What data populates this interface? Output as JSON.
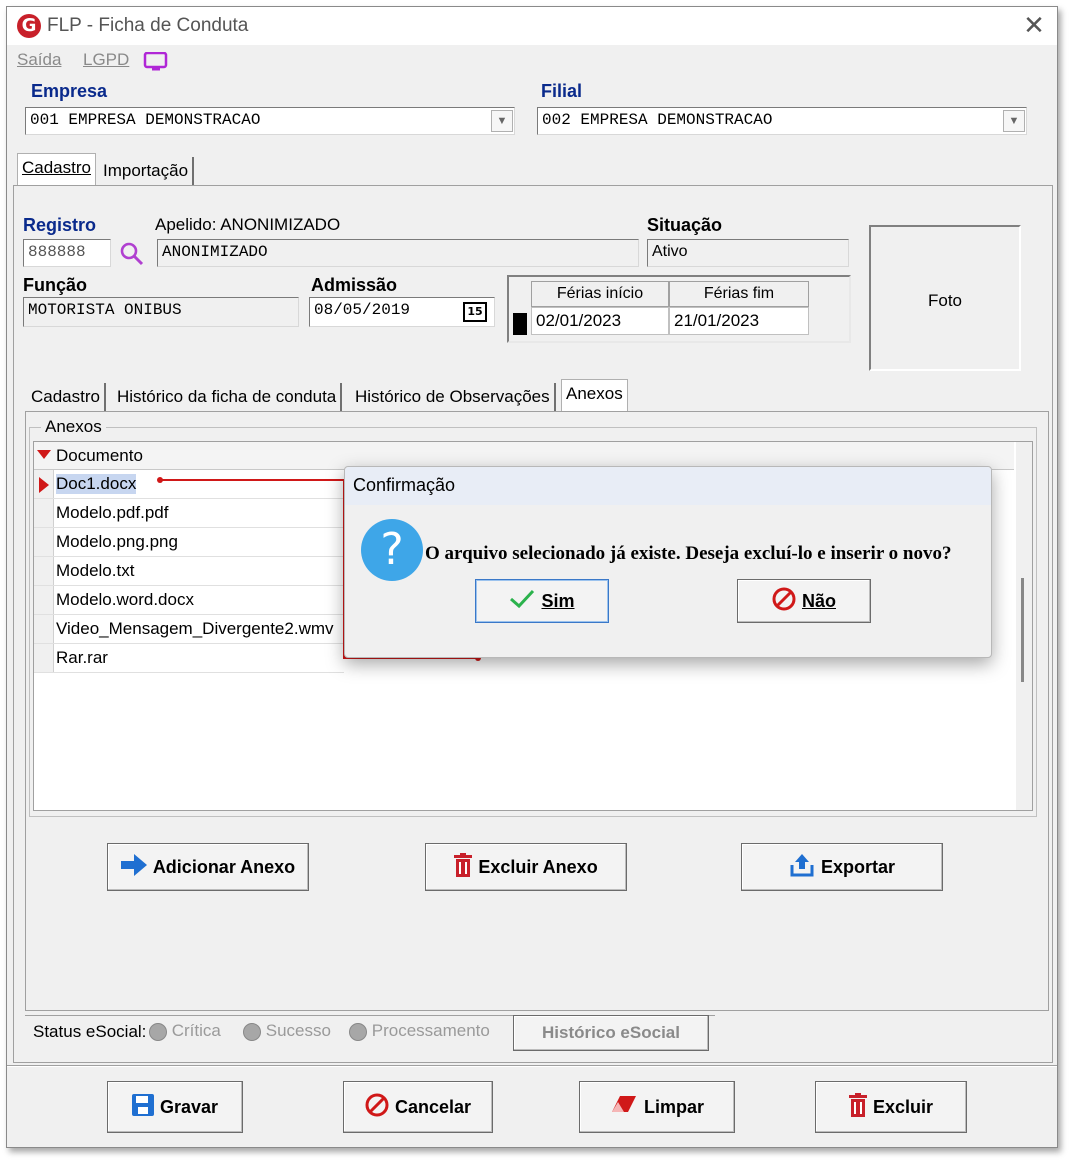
{
  "window": {
    "title": "FLP - Ficha de Conduta"
  },
  "menu": {
    "saida": "Saída",
    "lgpd": "LGPD"
  },
  "empresa": {
    "label": "Empresa",
    "value": "001 EMPRESA DEMONSTRACAO"
  },
  "filial": {
    "label": "Filial",
    "value": "002 EMPRESA DEMONSTRACAO"
  },
  "main_tabs": [
    "Cadastro",
    "Importação"
  ],
  "registro": {
    "label": "Registro",
    "value": "888888"
  },
  "apelido": {
    "label": "Apelido: ANONIMIZADO",
    "value": "ANONIMIZADO"
  },
  "situacao": {
    "label": "Situação",
    "value": "Ativo"
  },
  "funcao": {
    "label": "Função",
    "value": "MOTORISTA ONIBUS"
  },
  "admissao": {
    "label": "Admissão",
    "value": "08/05/2019",
    "cal": "15"
  },
  "ferias": {
    "inicio_label": "Férias início",
    "fim_label": "Férias fim",
    "inicio": "02/01/2023",
    "fim": "21/01/2023"
  },
  "foto": {
    "label": "Foto"
  },
  "sub_tabs": [
    "Cadastro",
    "Histórico da ficha de conduta",
    "Histórico de Observações",
    "Anexos"
  ],
  "anexos": {
    "group_label": "Anexos",
    "column": "Documento",
    "rows": [
      "Doc1.docx",
      "Modelo.pdf.pdf",
      "Modelo.png.png",
      "Modelo.txt",
      "Modelo.word.docx",
      "Video_Mensagem_Divergente2.wmv",
      "Rar.rar"
    ]
  },
  "anexo_buttons": {
    "add": "Adicionar Anexo",
    "delete": "Excluir Anexo",
    "export": "Exportar"
  },
  "status": {
    "label": "Status eSocial:",
    "critica": "Crítica",
    "sucesso": "Sucesso",
    "processamento": "Processamento",
    "historico": "Histórico eSocial"
  },
  "footer": {
    "gravar": "Gravar",
    "cancelar": "Cancelar",
    "limpar": "Limpar",
    "excluir": "Excluir"
  },
  "dialog": {
    "title": "Confirmação",
    "message": "O arquivo selecionado já existe. Deseja excluí-lo e inserir o novo?",
    "yes": "Sim",
    "no": "Não"
  },
  "colors": {
    "label_blue": "#0a2a8c",
    "accent_red": "#c8202a",
    "button_blue": "#1f6fd1",
    "annotation_red": "#d01818",
    "dialog_icon": "#3ea6e8"
  }
}
